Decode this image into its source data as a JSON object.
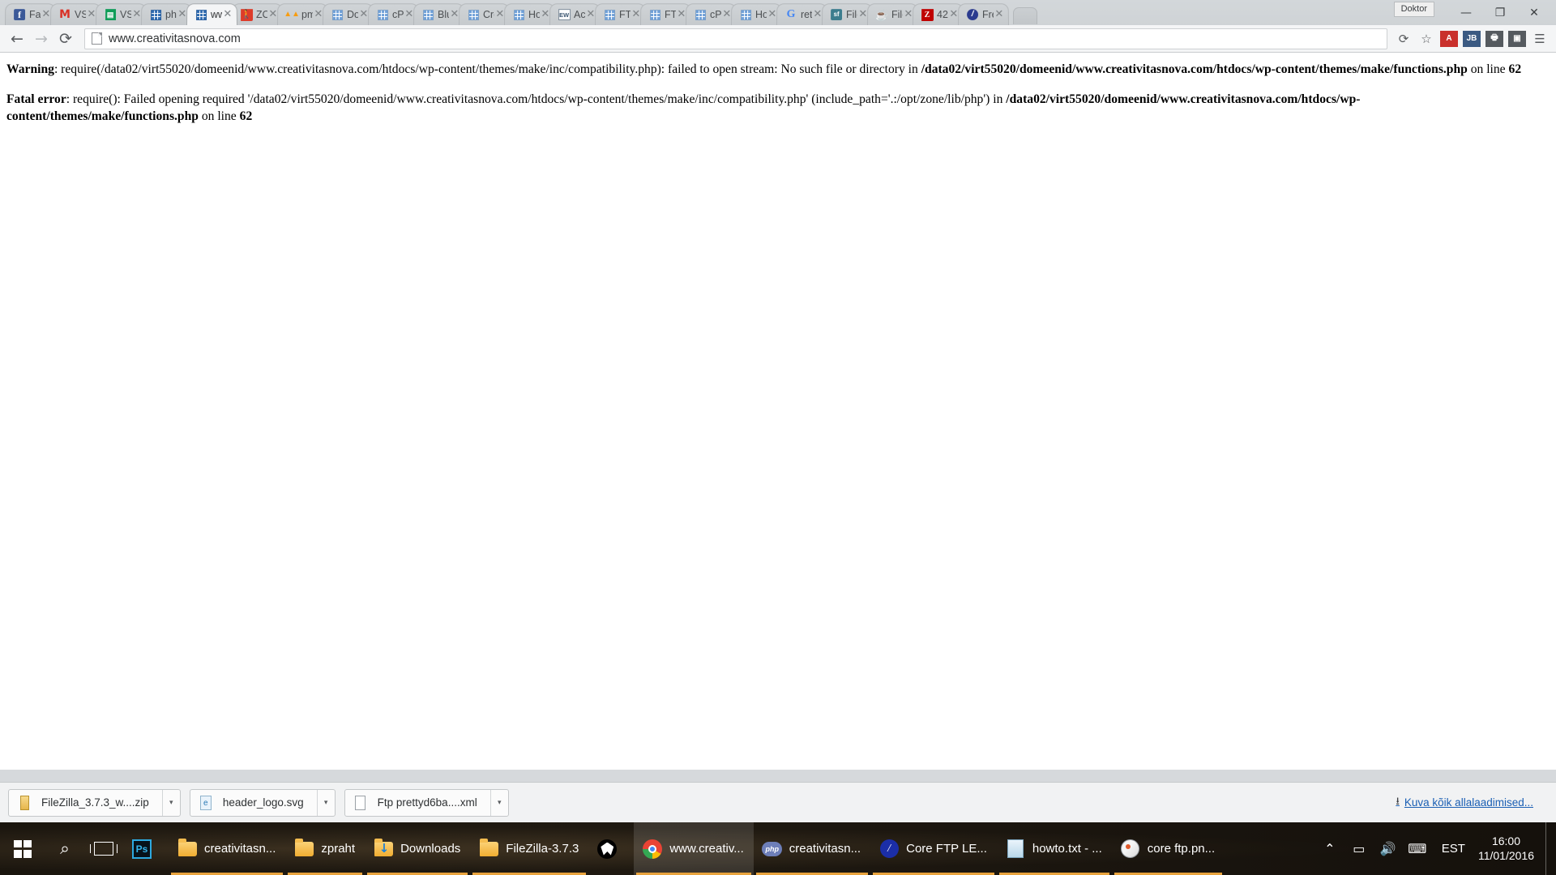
{
  "window": {
    "doktor_label": "Doktor",
    "minimize": "—",
    "maximize": "❐",
    "close": "✕"
  },
  "tabs": [
    {
      "title": "Fac",
      "favicon": "facebook-icon",
      "active": false
    },
    {
      "title": "VS",
      "favicon": "gmail-icon",
      "active": false
    },
    {
      "title": "VS",
      "favicon": "google-sheets-icon",
      "active": false
    },
    {
      "title": "php",
      "favicon": "phpmyadmin-grid-icon",
      "active": false
    },
    {
      "title": "ww",
      "favicon": "wordpress-grid-icon",
      "active": true
    },
    {
      "title": "ZO",
      "favicon": "zopim-runner-icon",
      "active": false
    },
    {
      "title": "pm",
      "favicon": "pma-icon",
      "active": false
    },
    {
      "title": "Do",
      "favicon": "grid-icon",
      "active": false
    },
    {
      "title": "cPa",
      "favicon": "grid-icon",
      "active": false
    },
    {
      "title": "Blu",
      "favicon": "grid-icon",
      "active": false
    },
    {
      "title": "Cre",
      "favicon": "grid-icon",
      "active": false
    },
    {
      "title": "Ho",
      "favicon": "grid-icon",
      "active": false
    },
    {
      "title": "Ac",
      "favicon": "ew-icon",
      "active": false
    },
    {
      "title": "FTF",
      "favicon": "grid-icon",
      "active": false
    },
    {
      "title": "FTF",
      "favicon": "grid-icon",
      "active": false
    },
    {
      "title": "cPa",
      "favicon": "grid-icon",
      "active": false
    },
    {
      "title": "Ho",
      "favicon": "grid-icon",
      "active": false
    },
    {
      "title": "ret",
      "favicon": "google-icon",
      "active": false
    },
    {
      "title": "File",
      "favicon": "sourceforge-icon",
      "active": false
    },
    {
      "title": "File",
      "favicon": "java-icon",
      "active": false
    },
    {
      "title": "42",
      "favicon": "filezilla-icon",
      "active": false
    },
    {
      "title": "Fre",
      "favicon": "blue-circle-icon",
      "active": false
    }
  ],
  "toolbar": {
    "back": "←",
    "forward": "→",
    "reload": "⟳",
    "url": "www.creativitasnova.com",
    "bookmark_star": "☆",
    "sync_icon": "⟳",
    "extensions": [
      {
        "name": "adblock-extension-icon",
        "label": "A",
        "color": "#c9302c"
      },
      {
        "name": "jsonview-extension-icon",
        "label": "JB",
        "color": "#3b5a82"
      },
      {
        "name": "printer-extension-icon",
        "label": "🖶",
        "color": "#555a5f"
      },
      {
        "name": "camera-extension-icon",
        "label": "▣",
        "color": "#555a5f"
      }
    ],
    "menu": "☰"
  },
  "page": {
    "errors": [
      {
        "label": "Warning",
        "segments": [
          {
            "text": ": require(/data02/virt55020/domeenid/www.creativitasnova.com/htdocs/wp-content/themes/make/inc/compatibility.php): failed to open stream: No such file or directory in ",
            "bold": false
          },
          {
            "text": "/data02/virt55020/domeenid/www.creativitasnova.com/htdocs/wp-content/themes/make/functions.php",
            "bold": true
          },
          {
            "text": " on line ",
            "bold": false
          },
          {
            "text": "62",
            "bold": true
          }
        ]
      },
      {
        "label": "Fatal error",
        "segments": [
          {
            "text": ": require(): Failed opening required '/data02/virt55020/domeenid/www.creativitasnova.com/htdocs/wp-content/themes/make/inc/compatibility.php' (include_path='.:/opt/zone/lib/php') in ",
            "bold": false
          },
          {
            "text": "/data02/virt55020/domeenid/www.creativitasnova.com/htdocs/wp-content/themes/make/functions.php",
            "bold": true
          },
          {
            "text": " on line ",
            "bold": false
          },
          {
            "text": "62",
            "bold": true
          }
        ]
      }
    ]
  },
  "downloads": {
    "items": [
      {
        "name": "FileZilla_3.7.3_w....zip",
        "icon": "zip-file-icon",
        "caret": "▾"
      },
      {
        "name": "header_logo.svg",
        "icon": "svg-file-icon",
        "caret": "▾"
      },
      {
        "name": "Ftp prettyd6ba....xml",
        "icon": "xml-file-icon",
        "caret": "▾"
      }
    ],
    "show_all": "Kuva kõik allalaadimised...",
    "show_all_arrow": "⭳"
  },
  "taskbar": {
    "start": "windows-logo",
    "search": "⌕",
    "task_view": "task-view-icon",
    "apps": [
      {
        "label": "",
        "icon": "photoshop-icon",
        "running": false,
        "focused": false
      },
      {
        "label": "creativitasn...",
        "icon": "folder-icon",
        "running": true,
        "focused": false
      },
      {
        "label": "zpraht",
        "icon": "folder-icon",
        "running": true,
        "focused": false
      },
      {
        "label": "Downloads",
        "icon": "folder-download-icon",
        "running": true,
        "focused": false
      },
      {
        "label": "FileZilla-3.7.3",
        "icon": "folder-icon",
        "running": true,
        "focused": false
      },
      {
        "label": "",
        "icon": "foobar2000-icon",
        "running": false,
        "focused": false
      },
      {
        "label": "www.creativ...",
        "icon": "chrome-icon",
        "running": true,
        "focused": true
      },
      {
        "label": "creativitasn...",
        "icon": "php-icon",
        "running": true,
        "focused": false
      },
      {
        "label": "Core FTP LE...",
        "icon": "core-ftp-icon",
        "running": true,
        "focused": false
      },
      {
        "label": "howto.txt - ...",
        "icon": "notepad-icon",
        "running": true,
        "focused": false
      },
      {
        "label": "core ftp.pn...",
        "icon": "paint-icon",
        "running": true,
        "focused": false
      }
    ],
    "tray": {
      "overflow": "⌃",
      "battery": "▭",
      "volume": "🔊",
      "keyboard": "⌨",
      "language": "EST",
      "time": "16:00",
      "date": "11/01/2016"
    }
  }
}
